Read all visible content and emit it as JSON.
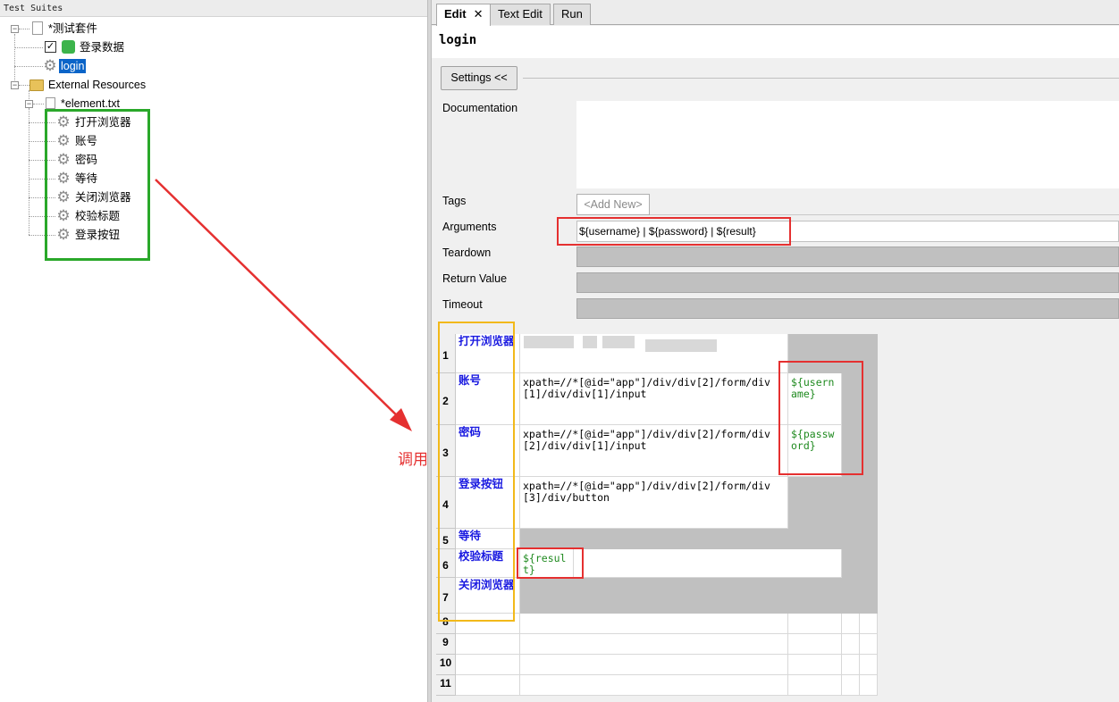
{
  "left": {
    "header": "Test Suites",
    "suite_name": "*测试套件",
    "data_item": "登录数据",
    "login_item": "login",
    "external": "External Resources",
    "element_file": "*element.txt",
    "keywords": [
      "打开浏览器",
      "账号",
      "密码",
      "等待",
      "关闭浏览器",
      "校验标题",
      "登录按钮"
    ]
  },
  "tabs": {
    "edit": "Edit",
    "close": "✕",
    "text_edit": "Text Edit",
    "run": "Run"
  },
  "editor": {
    "name": "login",
    "settings_label": "Settings <<",
    "labels": {
      "documentation": "Documentation",
      "tags": "Tags",
      "arguments": "Arguments",
      "teardown": "Teardown",
      "return_value": "Return Value",
      "timeout": "Timeout"
    },
    "tags_add": "<Add New>",
    "arguments_value": "${username} | ${password} | ${result}"
  },
  "grid": {
    "rows": [
      {
        "num": "1",
        "keyword": "打开浏览器",
        "arg1": "",
        "arg2": ""
      },
      {
        "num": "2",
        "keyword": "账号",
        "arg1": "xpath=//*[@id=\"app\"]/div/div[2]/form/div[1]/div/div[1]/input",
        "arg2": "${username}"
      },
      {
        "num": "3",
        "keyword": "密码",
        "arg1": "xpath=//*[@id=\"app\"]/div/div[2]/form/div[2]/div/div[1]/input",
        "arg2": "${password}"
      },
      {
        "num": "4",
        "keyword": "登录按钮",
        "arg1": "xpath=//*[@id=\"app\"]/div/div[2]/form/div[3]/div/button",
        "arg2": ""
      },
      {
        "num": "5",
        "keyword": "等待",
        "arg1": "",
        "arg2": ""
      },
      {
        "num": "6",
        "keyword": "校验标题",
        "arg1": "${result}",
        "arg2": ""
      },
      {
        "num": "7",
        "keyword": "关闭浏览器",
        "arg1": "",
        "arg2": ""
      },
      {
        "num": "8"
      },
      {
        "num": "9"
      },
      {
        "num": "10"
      },
      {
        "num": "11"
      }
    ]
  },
  "annotation": {
    "call_label": "调用",
    "red": "#e53030",
    "green": "#2aa82a",
    "yellow": "#f2b91a"
  }
}
